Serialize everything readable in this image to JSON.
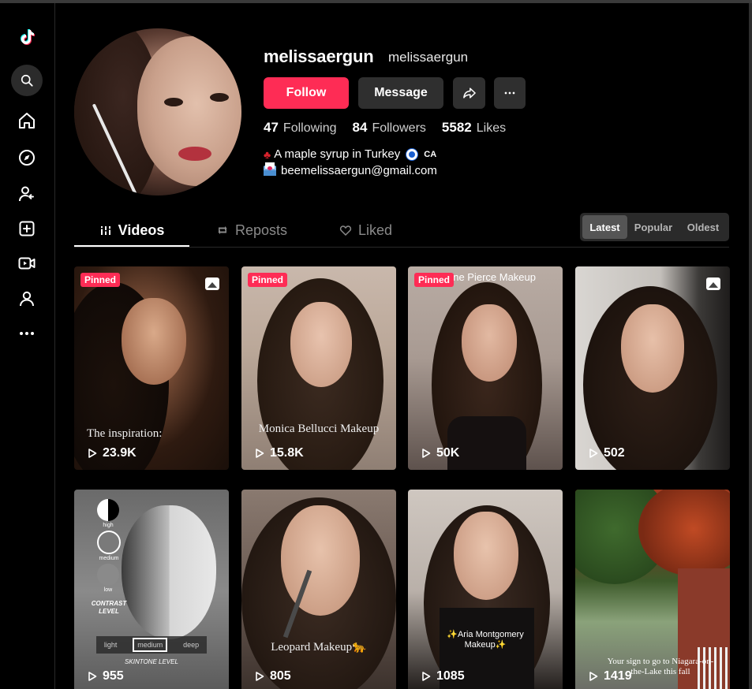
{
  "sidebar": {
    "icons": [
      "tiktok-logo-icon",
      "search-icon",
      "home-icon",
      "explore-icon",
      "following-icon",
      "upload-icon",
      "live-icon",
      "profile-icon",
      "more-icon"
    ]
  },
  "profile": {
    "username": "melissaergun",
    "nickname": "melissaergun",
    "follow_label": "Follow",
    "message_label": "Message",
    "stats": [
      {
        "num": "47",
        "label": "Following"
      },
      {
        "num": "84",
        "label": "Followers"
      },
      {
        "num": "5582",
        "label": "Likes"
      }
    ],
    "bio_line1": "A maple syrup in Turkey",
    "bio_country": "CA",
    "bio_line2": "beemelissaergun@gmail.com"
  },
  "tabs": {
    "videos": "Videos",
    "reposts": "Reposts",
    "liked": "Liked"
  },
  "sort": {
    "latest": "Latest",
    "popular": "Popular",
    "oldest": "Oldest"
  },
  "videos": [
    {
      "pinned": "Pinned",
      "views": "23.9K",
      "overlay": "The inspiration:"
    },
    {
      "pinned": "Pinned",
      "views": "15.8K",
      "overlay": "Monica Bellucci Makeup"
    },
    {
      "pinned": "Pinned",
      "views": "50K",
      "title": "rine Pierce Makeup"
    },
    {
      "views": "502"
    },
    {
      "views": "955",
      "labels": [
        "high",
        "medium",
        "low",
        "CONTRAST LEVEL",
        "light",
        "medium",
        "deep",
        "SKINTONE LEVEL"
      ]
    },
    {
      "views": "805",
      "overlay": "Leopard Makeup🐆"
    },
    {
      "views": "1085",
      "overlay": "✨Aria Montgomery Makeup✨"
    },
    {
      "views": "1419",
      "overlay": "Your sign to go to Niagara-on-the-Lake this fall"
    }
  ],
  "colors": {
    "accent": "#fe2c55",
    "background": "#000000",
    "button_dark": "#2f2f2f"
  }
}
